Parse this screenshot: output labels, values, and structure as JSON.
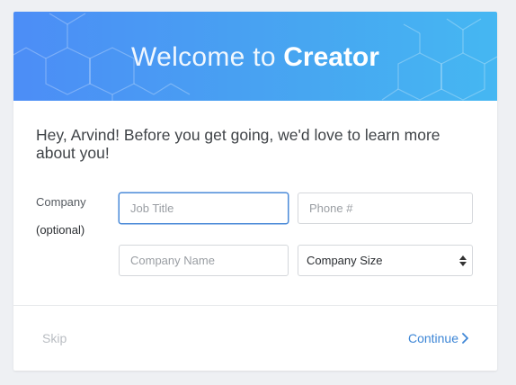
{
  "banner": {
    "title_prefix": "Welcome to",
    "title_brand": "Creator"
  },
  "intro": {
    "message": "Hey, Arvind! Before you get going, we'd love to learn more about you!"
  },
  "form": {
    "section_label": "Company",
    "section_sublabel": "(optional)",
    "job_title": {
      "value": "",
      "placeholder": "Job Title",
      "focused": true
    },
    "phone": {
      "value": "",
      "placeholder": "Phone #"
    },
    "company_name": {
      "value": "",
      "placeholder": "Company Name"
    },
    "company_size": {
      "selected": "Company Size"
    }
  },
  "footer": {
    "skip_label": "Skip",
    "continue_label": "Continue",
    "continue_icon": "chevron-right-icon"
  },
  "colors": {
    "banner_start": "#4c8df6",
    "banner_end": "#45b7f2",
    "accent": "#3d86d6",
    "focus_border": "#4a8ad8"
  }
}
